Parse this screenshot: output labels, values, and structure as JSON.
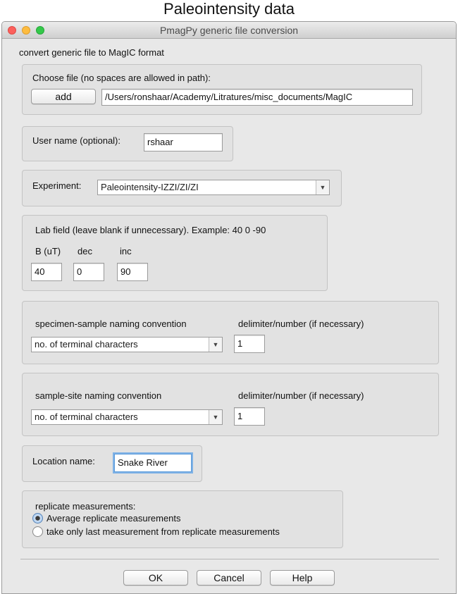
{
  "page_heading": "Paleointensity data",
  "window": {
    "title": "PmagPy generic file conversion"
  },
  "intro": "convert generic file to MagIC format",
  "choose_file": {
    "label": "Choose file (no spaces are allowed in path):",
    "add_button": "add",
    "path": "/Users/ronshaar/Academy/Litratures/misc_documents/MagIC"
  },
  "user_name": {
    "label": "User name (optional):",
    "value": "rshaar"
  },
  "experiment": {
    "label": "Experiment:",
    "value": "Paleointensity-IZZI/ZI/ZI"
  },
  "lab_field": {
    "label": "Lab field (leave blank if unnecessary). Example: 40 0 -90",
    "b_label": "B (uT)",
    "dec_label": "dec",
    "inc_label": "inc",
    "b_value": "40",
    "dec_value": "0",
    "inc_value": "90"
  },
  "specimen_sample": {
    "label": "specimen-sample naming convention",
    "delimiter_label": "delimiter/number (if necessary)",
    "selected": "no. of terminal characters",
    "delimiter_value": "1"
  },
  "sample_site": {
    "label": "sample-site naming convention",
    "delimiter_label": "delimiter/number (if necessary)",
    "selected": "no. of terminal characters",
    "delimiter_value": "1"
  },
  "location": {
    "label": "Location name:",
    "value": "Snake River"
  },
  "replicate": {
    "label": "replicate measurements:",
    "option_average": "Average replicate measurements",
    "option_last": "take only last measurement from replicate measurements",
    "selected": "average"
  },
  "buttons": {
    "ok": "OK",
    "cancel": "Cancel",
    "help": "Help"
  },
  "colors": {
    "window_bg": "#e8e8e8",
    "group_bg": "#e2e2e2",
    "focus_ring": "#7fb2e6"
  }
}
